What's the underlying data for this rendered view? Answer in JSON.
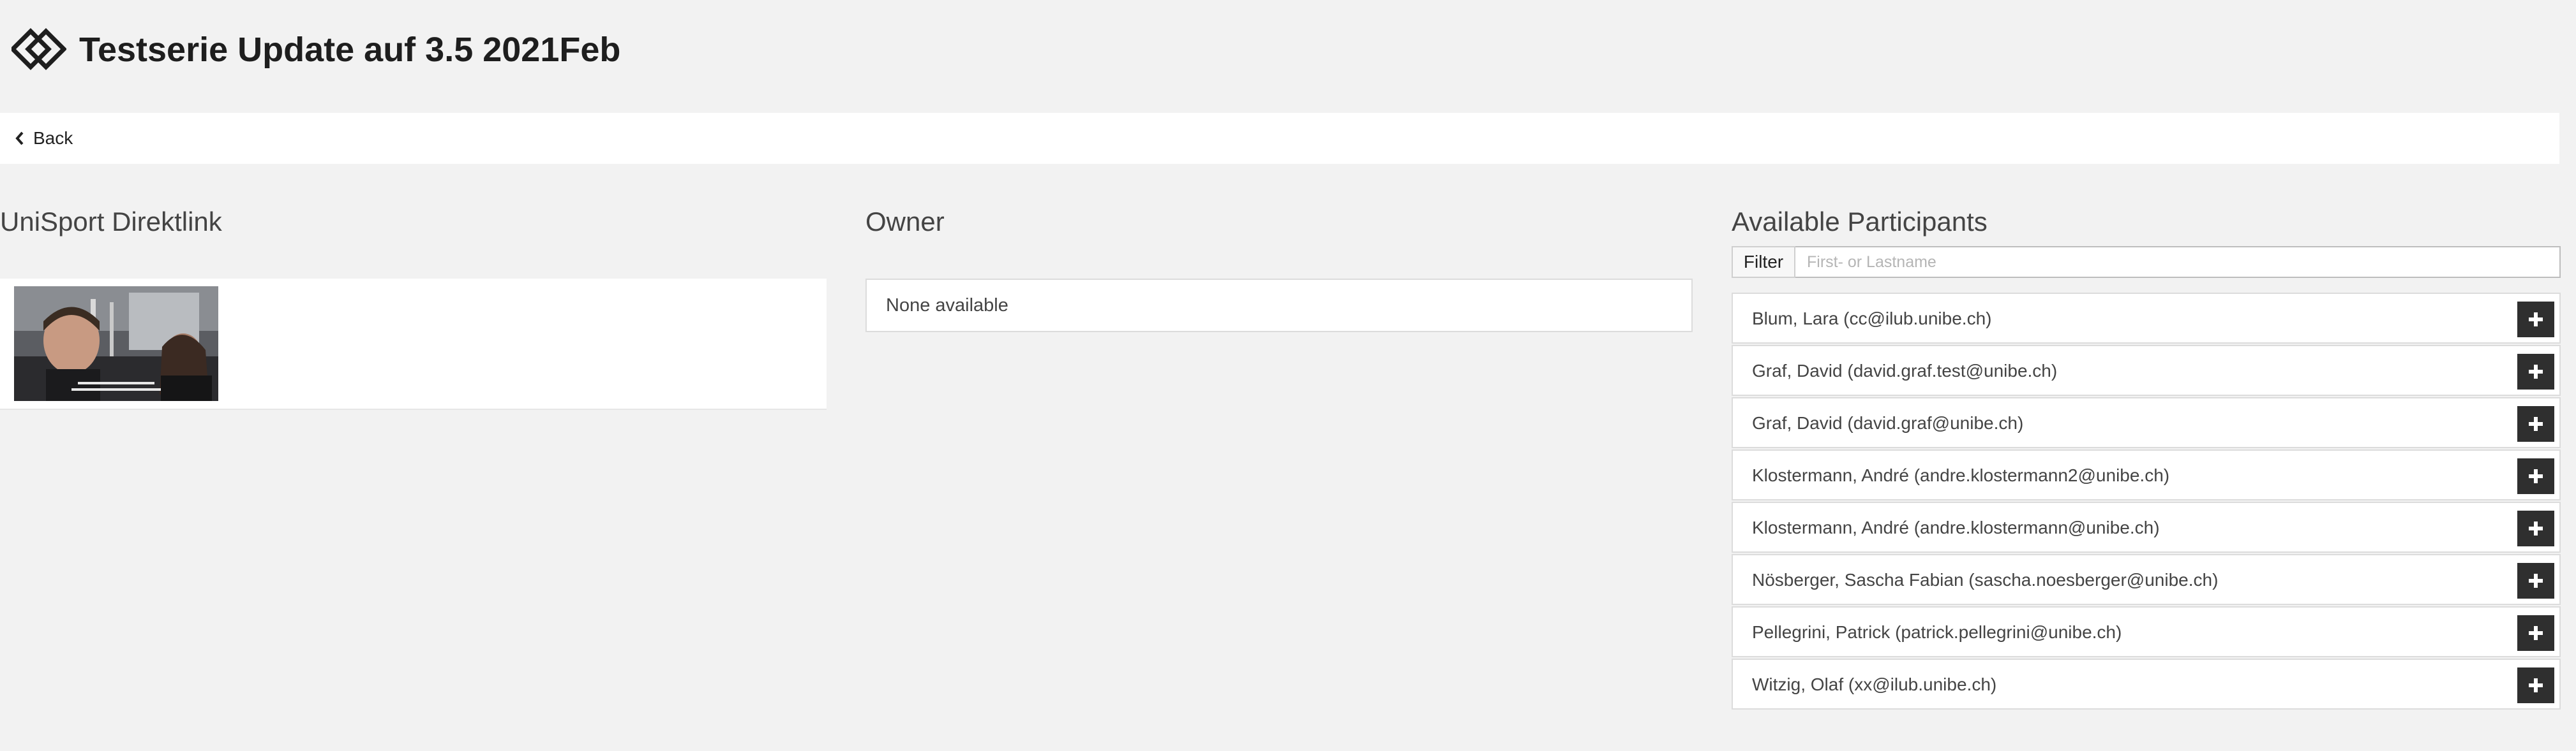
{
  "header": {
    "title": "Testserie Update auf 3.5 2021Feb",
    "logo_icon": "diamond-logo-icon"
  },
  "nav": {
    "back_label": "Back",
    "back_icon": "chevron-left-icon"
  },
  "left_column": {
    "title": "UniSport Direktlink",
    "video": {
      "thumbnail_icon": "video-thumbnail"
    }
  },
  "owner_column": {
    "title": "Owner",
    "empty_text": "None available"
  },
  "participants_column": {
    "title": "Available Participants",
    "filter_label": "Filter",
    "filter_placeholder": "First- or Lastname",
    "filter_value": "",
    "add_icon": "plus-icon",
    "items": [
      {
        "label": "Blum, Lara (cc@ilub.unibe.ch)"
      },
      {
        "label": "Graf, David (david.graf.test@unibe.ch)"
      },
      {
        "label": "Graf, David (david.graf@unibe.ch)"
      },
      {
        "label": "Klostermann, André (andre.klostermann2@unibe.ch)"
      },
      {
        "label": "Klostermann, André (andre.klostermann@unibe.ch)"
      },
      {
        "label": "Nösberger, Sascha Fabian (sascha.noesberger@unibe.ch)"
      },
      {
        "label": "Pellegrini, Patrick (patrick.pellegrini@unibe.ch)"
      },
      {
        "label": "Witzig, Olaf (xx@ilub.unibe.ch)"
      }
    ]
  },
  "colors": {
    "background": "#f2f2f2",
    "panel": "#ffffff",
    "button": "#2f2f2f",
    "border": "#dcdcdc"
  }
}
